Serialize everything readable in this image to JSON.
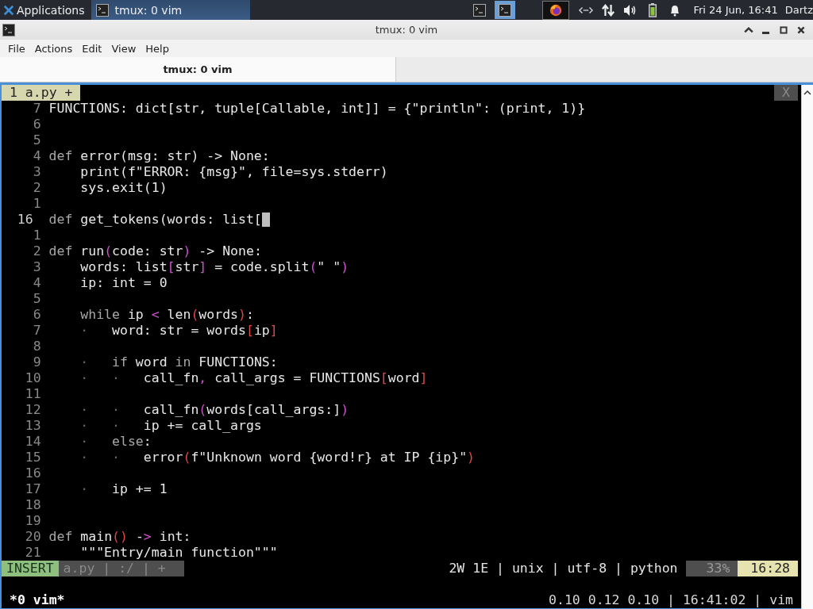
{
  "panel": {
    "apps_label": "Applications",
    "taskbar": [
      {
        "label": "tmux: 0 vim",
        "selected": true
      }
    ],
    "workspaces": [
      {
        "selected": false
      },
      {
        "selected": true
      }
    ],
    "clock": "Fri 24 Jun, 16:41",
    "user": "Dartz"
  },
  "window": {
    "title": "tmux: 0 vim",
    "menu": [
      "File",
      "Actions",
      "Edit",
      "View",
      "Help"
    ],
    "tabs": [
      {
        "label": "tmux: 0 vim",
        "selected": true
      }
    ]
  },
  "vim": {
    "tabline": {
      "tabs": [
        {
          "label": "1 a.py +",
          "selected": true
        }
      ],
      "close": "X"
    },
    "lines": [
      {
        "number": "7",
        "current": false,
        "segments": [
          {
            "t": "FUNCTIONS: dict[str, tuple[Callable, int]] = {\"println\": (print, 1)}",
            "kind": "plain"
          }
        ]
      },
      {
        "number": "6",
        "current": false
      },
      {
        "number": "5",
        "current": false
      },
      {
        "number": "4",
        "current": false,
        "segments": [
          {
            "t": "def ",
            "kind": "kw"
          },
          {
            "t": "error(msg: str) -> None:",
            "kind": "plain"
          }
        ]
      },
      {
        "number": "3",
        "current": false,
        "segments": [
          {
            "t": "    print(f\"ERROR: {msg}\", file=sys.stderr)",
            "kind": "plain"
          }
        ]
      },
      {
        "number": "2",
        "current": false,
        "segments": [
          {
            "t": "    sys.exit(1)",
            "kind": "plain"
          }
        ]
      },
      {
        "number": "1",
        "current": false
      },
      {
        "number": "16",
        "current": true,
        "cursor": true,
        "segments": [
          {
            "t": "def ",
            "kind": "kw"
          },
          {
            "t": "get_tokens(words: list[",
            "kind": "plain"
          }
        ]
      },
      {
        "number": "1",
        "current": false
      },
      {
        "number": "2",
        "current": false,
        "segments": [
          {
            "t": "def ",
            "kind": "kw"
          },
          {
            "t": "run",
            "kind": "plain"
          },
          {
            "t": "(",
            "kind": "p1"
          },
          {
            "t": "code: str",
            "kind": "plain"
          },
          {
            "t": ")",
            "kind": "p1"
          },
          {
            "t": " -> None:",
            "kind": "plain"
          }
        ]
      },
      {
        "number": "3",
        "current": false,
        "segments": [
          {
            "t": "    words: list",
            "kind": "plain"
          },
          {
            "t": "[",
            "kind": "p1"
          },
          {
            "t": "str",
            "kind": "plain"
          },
          {
            "t": "]",
            "kind": "p1"
          },
          {
            "t": " = code.split",
            "kind": "plain"
          },
          {
            "t": "(",
            "kind": "p1"
          },
          {
            "t": "\" \"",
            "kind": "plain"
          },
          {
            "t": ")",
            "kind": "p1"
          }
        ]
      },
      {
        "number": "4",
        "current": false,
        "segments": [
          {
            "t": "    ip: int = 0",
            "kind": "plain"
          }
        ]
      },
      {
        "number": "5",
        "current": false
      },
      {
        "number": "6",
        "current": false,
        "segments": [
          {
            "t": "    while",
            "kind": "kw"
          },
          {
            "t": " ip ",
            "kind": "plain"
          },
          {
            "t": "<",
            "kind": "p1"
          },
          {
            "t": " len",
            "kind": "plain"
          },
          {
            "t": "(",
            "kind": "p2"
          },
          {
            "t": "words",
            "kind": "plain"
          },
          {
            "t": ")",
            "kind": "p2"
          },
          {
            "t": ":",
            "kind": "plain"
          }
        ]
      },
      {
        "number": "7",
        "current": false,
        "segments": [
          {
            "t": "    ·   ",
            "kind": "guide"
          },
          {
            "t": "word: str = words",
            "kind": "plain"
          },
          {
            "t": "[",
            "kind": "p2"
          },
          {
            "t": "ip",
            "kind": "plain"
          },
          {
            "t": "]",
            "kind": "p2"
          }
        ]
      },
      {
        "number": "8",
        "current": false
      },
      {
        "number": "9",
        "current": false,
        "segments": [
          {
            "t": "    ·   ",
            "kind": "guide"
          },
          {
            "t": "if",
            "kind": "kw"
          },
          {
            "t": " word ",
            "kind": "plain"
          },
          {
            "t": "in",
            "kind": "kw"
          },
          {
            "t": " FUNCTIONS:",
            "kind": "plain"
          }
        ]
      },
      {
        "number": "10",
        "current": false,
        "segments": [
          {
            "t": "    ·   ·   ",
            "kind": "guide"
          },
          {
            "t": "call_fn",
            "kind": "plain"
          },
          {
            "t": ",",
            "kind": "p1"
          },
          {
            "t": " call_args = FUNCTIONS",
            "kind": "plain"
          },
          {
            "t": "[",
            "kind": "p2"
          },
          {
            "t": "word",
            "kind": "plain"
          },
          {
            "t": "]",
            "kind": "p2"
          }
        ]
      },
      {
        "number": "11",
        "current": false
      },
      {
        "number": "12",
        "current": false,
        "segments": [
          {
            "t": "    ·   ·   ",
            "kind": "guide"
          },
          {
            "t": "call_fn",
            "kind": "plain"
          },
          {
            "t": "(",
            "kind": "p1"
          },
          {
            "t": "words[call_args:]",
            "kind": "plain"
          },
          {
            "t": ")",
            "kind": "p1"
          }
        ]
      },
      {
        "number": "13",
        "current": false,
        "segments": [
          {
            "t": "    ·   ·   ",
            "kind": "guide"
          },
          {
            "t": "ip += call_args",
            "kind": "plain"
          }
        ]
      },
      {
        "number": "14",
        "current": false,
        "segments": [
          {
            "t": "    ·   ",
            "kind": "guide"
          },
          {
            "t": "else",
            "kind": "kw"
          },
          {
            "t": ":",
            "kind": "plain"
          }
        ]
      },
      {
        "number": "15",
        "current": false,
        "segments": [
          {
            "t": "    ·   ·   ",
            "kind": "guide"
          },
          {
            "t": "error",
            "kind": "plain"
          },
          {
            "t": "(",
            "kind": "p2"
          },
          {
            "t": "f\"Unknown word {word!r} at IP {ip}\"",
            "kind": "plain"
          },
          {
            "t": ")",
            "kind": "p2"
          }
        ]
      },
      {
        "number": "16",
        "current": false
      },
      {
        "number": "17",
        "current": false,
        "segments": [
          {
            "t": "    ·   ",
            "kind": "guide"
          },
          {
            "t": "ip += 1",
            "kind": "plain"
          }
        ]
      },
      {
        "number": "18",
        "current": false
      },
      {
        "number": "19",
        "current": false
      },
      {
        "number": "20",
        "current": false,
        "segments": [
          {
            "t": "def ",
            "kind": "kw"
          },
          {
            "t": "main",
            "kind": "plain"
          },
          {
            "t": "()",
            "kind": "p2"
          },
          {
            "t": " -",
            "kind": "plain"
          },
          {
            "t": ">",
            "kind": "p1"
          },
          {
            "t": " int:",
            "kind": "plain"
          }
        ]
      },
      {
        "number": "21",
        "current": false,
        "segments": [
          {
            "t": "    \"\"\"Entry/main function\"\"\"",
            "kind": "plain"
          }
        ]
      }
    ],
    "statusline": {
      "mode": "INSERT",
      "file": "a.py | :/ | +",
      "info": "2W 1E | unix | utf-8 | python",
      "percent": "33%",
      "position": "16:28"
    }
  },
  "tmux": {
    "window": "*0 vim*",
    "status": "0.10 0.12 0.10 | 16:41:02 | vim"
  }
}
